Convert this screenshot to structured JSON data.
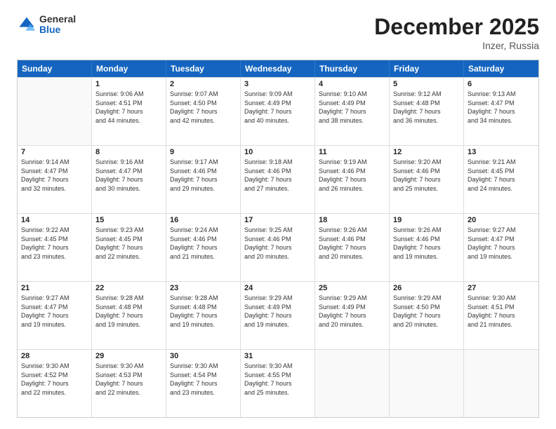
{
  "header": {
    "logo_general": "General",
    "logo_blue": "Blue",
    "month_title": "December 2025",
    "location": "Inzer, Russia"
  },
  "days_of_week": [
    "Sunday",
    "Monday",
    "Tuesday",
    "Wednesday",
    "Thursday",
    "Friday",
    "Saturday"
  ],
  "weeks": [
    [
      {
        "day": "",
        "sunrise": "",
        "sunset": "",
        "daylight": "",
        "empty": true
      },
      {
        "day": "1",
        "sunrise": "Sunrise: 9:06 AM",
        "sunset": "Sunset: 4:51 PM",
        "daylight": "Daylight: 7 hours",
        "daylight2": "and 44 minutes."
      },
      {
        "day": "2",
        "sunrise": "Sunrise: 9:07 AM",
        "sunset": "Sunset: 4:50 PM",
        "daylight": "Daylight: 7 hours",
        "daylight2": "and 42 minutes."
      },
      {
        "day": "3",
        "sunrise": "Sunrise: 9:09 AM",
        "sunset": "Sunset: 4:49 PM",
        "daylight": "Daylight: 7 hours",
        "daylight2": "and 40 minutes."
      },
      {
        "day": "4",
        "sunrise": "Sunrise: 9:10 AM",
        "sunset": "Sunset: 4:49 PM",
        "daylight": "Daylight: 7 hours",
        "daylight2": "and 38 minutes."
      },
      {
        "day": "5",
        "sunrise": "Sunrise: 9:12 AM",
        "sunset": "Sunset: 4:48 PM",
        "daylight": "Daylight: 7 hours",
        "daylight2": "and 36 minutes."
      },
      {
        "day": "6",
        "sunrise": "Sunrise: 9:13 AM",
        "sunset": "Sunset: 4:47 PM",
        "daylight": "Daylight: 7 hours",
        "daylight2": "and 34 minutes."
      }
    ],
    [
      {
        "day": "7",
        "sunrise": "Sunrise: 9:14 AM",
        "sunset": "Sunset: 4:47 PM",
        "daylight": "Daylight: 7 hours",
        "daylight2": "and 32 minutes."
      },
      {
        "day": "8",
        "sunrise": "Sunrise: 9:16 AM",
        "sunset": "Sunset: 4:47 PM",
        "daylight": "Daylight: 7 hours",
        "daylight2": "and 30 minutes."
      },
      {
        "day": "9",
        "sunrise": "Sunrise: 9:17 AM",
        "sunset": "Sunset: 4:46 PM",
        "daylight": "Daylight: 7 hours",
        "daylight2": "and 29 minutes."
      },
      {
        "day": "10",
        "sunrise": "Sunrise: 9:18 AM",
        "sunset": "Sunset: 4:46 PM",
        "daylight": "Daylight: 7 hours",
        "daylight2": "and 27 minutes."
      },
      {
        "day": "11",
        "sunrise": "Sunrise: 9:19 AM",
        "sunset": "Sunset: 4:46 PM",
        "daylight": "Daylight: 7 hours",
        "daylight2": "and 26 minutes."
      },
      {
        "day": "12",
        "sunrise": "Sunrise: 9:20 AM",
        "sunset": "Sunset: 4:46 PM",
        "daylight": "Daylight: 7 hours",
        "daylight2": "and 25 minutes."
      },
      {
        "day": "13",
        "sunrise": "Sunrise: 9:21 AM",
        "sunset": "Sunset: 4:45 PM",
        "daylight": "Daylight: 7 hours",
        "daylight2": "and 24 minutes."
      }
    ],
    [
      {
        "day": "14",
        "sunrise": "Sunrise: 9:22 AM",
        "sunset": "Sunset: 4:45 PM",
        "daylight": "Daylight: 7 hours",
        "daylight2": "and 23 minutes."
      },
      {
        "day": "15",
        "sunrise": "Sunrise: 9:23 AM",
        "sunset": "Sunset: 4:45 PM",
        "daylight": "Daylight: 7 hours",
        "daylight2": "and 22 minutes."
      },
      {
        "day": "16",
        "sunrise": "Sunrise: 9:24 AM",
        "sunset": "Sunset: 4:46 PM",
        "daylight": "Daylight: 7 hours",
        "daylight2": "and 21 minutes."
      },
      {
        "day": "17",
        "sunrise": "Sunrise: 9:25 AM",
        "sunset": "Sunset: 4:46 PM",
        "daylight": "Daylight: 7 hours",
        "daylight2": "and 20 minutes."
      },
      {
        "day": "18",
        "sunrise": "Sunrise: 9:26 AM",
        "sunset": "Sunset: 4:46 PM",
        "daylight": "Daylight: 7 hours",
        "daylight2": "and 20 minutes."
      },
      {
        "day": "19",
        "sunrise": "Sunrise: 9:26 AM",
        "sunset": "Sunset: 4:46 PM",
        "daylight": "Daylight: 7 hours",
        "daylight2": "and 19 minutes."
      },
      {
        "day": "20",
        "sunrise": "Sunrise: 9:27 AM",
        "sunset": "Sunset: 4:47 PM",
        "daylight": "Daylight: 7 hours",
        "daylight2": "and 19 minutes."
      }
    ],
    [
      {
        "day": "21",
        "sunrise": "Sunrise: 9:27 AM",
        "sunset": "Sunset: 4:47 PM",
        "daylight": "Daylight: 7 hours",
        "daylight2": "and 19 minutes."
      },
      {
        "day": "22",
        "sunrise": "Sunrise: 9:28 AM",
        "sunset": "Sunset: 4:48 PM",
        "daylight": "Daylight: 7 hours",
        "daylight2": "and 19 minutes."
      },
      {
        "day": "23",
        "sunrise": "Sunrise: 9:28 AM",
        "sunset": "Sunset: 4:48 PM",
        "daylight": "Daylight: 7 hours",
        "daylight2": "and 19 minutes."
      },
      {
        "day": "24",
        "sunrise": "Sunrise: 9:29 AM",
        "sunset": "Sunset: 4:49 PM",
        "daylight": "Daylight: 7 hours",
        "daylight2": "and 19 minutes."
      },
      {
        "day": "25",
        "sunrise": "Sunrise: 9:29 AM",
        "sunset": "Sunset: 4:49 PM",
        "daylight": "Daylight: 7 hours",
        "daylight2": "and 20 minutes."
      },
      {
        "day": "26",
        "sunrise": "Sunrise: 9:29 AM",
        "sunset": "Sunset: 4:50 PM",
        "daylight": "Daylight: 7 hours",
        "daylight2": "and 20 minutes."
      },
      {
        "day": "27",
        "sunrise": "Sunrise: 9:30 AM",
        "sunset": "Sunset: 4:51 PM",
        "daylight": "Daylight: 7 hours",
        "daylight2": "and 21 minutes."
      }
    ],
    [
      {
        "day": "28",
        "sunrise": "Sunrise: 9:30 AM",
        "sunset": "Sunset: 4:52 PM",
        "daylight": "Daylight: 7 hours",
        "daylight2": "and 22 minutes."
      },
      {
        "day": "29",
        "sunrise": "Sunrise: 9:30 AM",
        "sunset": "Sunset: 4:53 PM",
        "daylight": "Daylight: 7 hours",
        "daylight2": "and 22 minutes."
      },
      {
        "day": "30",
        "sunrise": "Sunrise: 9:30 AM",
        "sunset": "Sunset: 4:54 PM",
        "daylight": "Daylight: 7 hours",
        "daylight2": "and 23 minutes."
      },
      {
        "day": "31",
        "sunrise": "Sunrise: 9:30 AM",
        "sunset": "Sunset: 4:55 PM",
        "daylight": "Daylight: 7 hours",
        "daylight2": "and 25 minutes."
      },
      {
        "day": "",
        "sunrise": "",
        "sunset": "",
        "daylight": "",
        "daylight2": "",
        "empty": true
      },
      {
        "day": "",
        "sunrise": "",
        "sunset": "",
        "daylight": "",
        "daylight2": "",
        "empty": true
      },
      {
        "day": "",
        "sunrise": "",
        "sunset": "",
        "daylight": "",
        "daylight2": "",
        "empty": true
      }
    ]
  ]
}
